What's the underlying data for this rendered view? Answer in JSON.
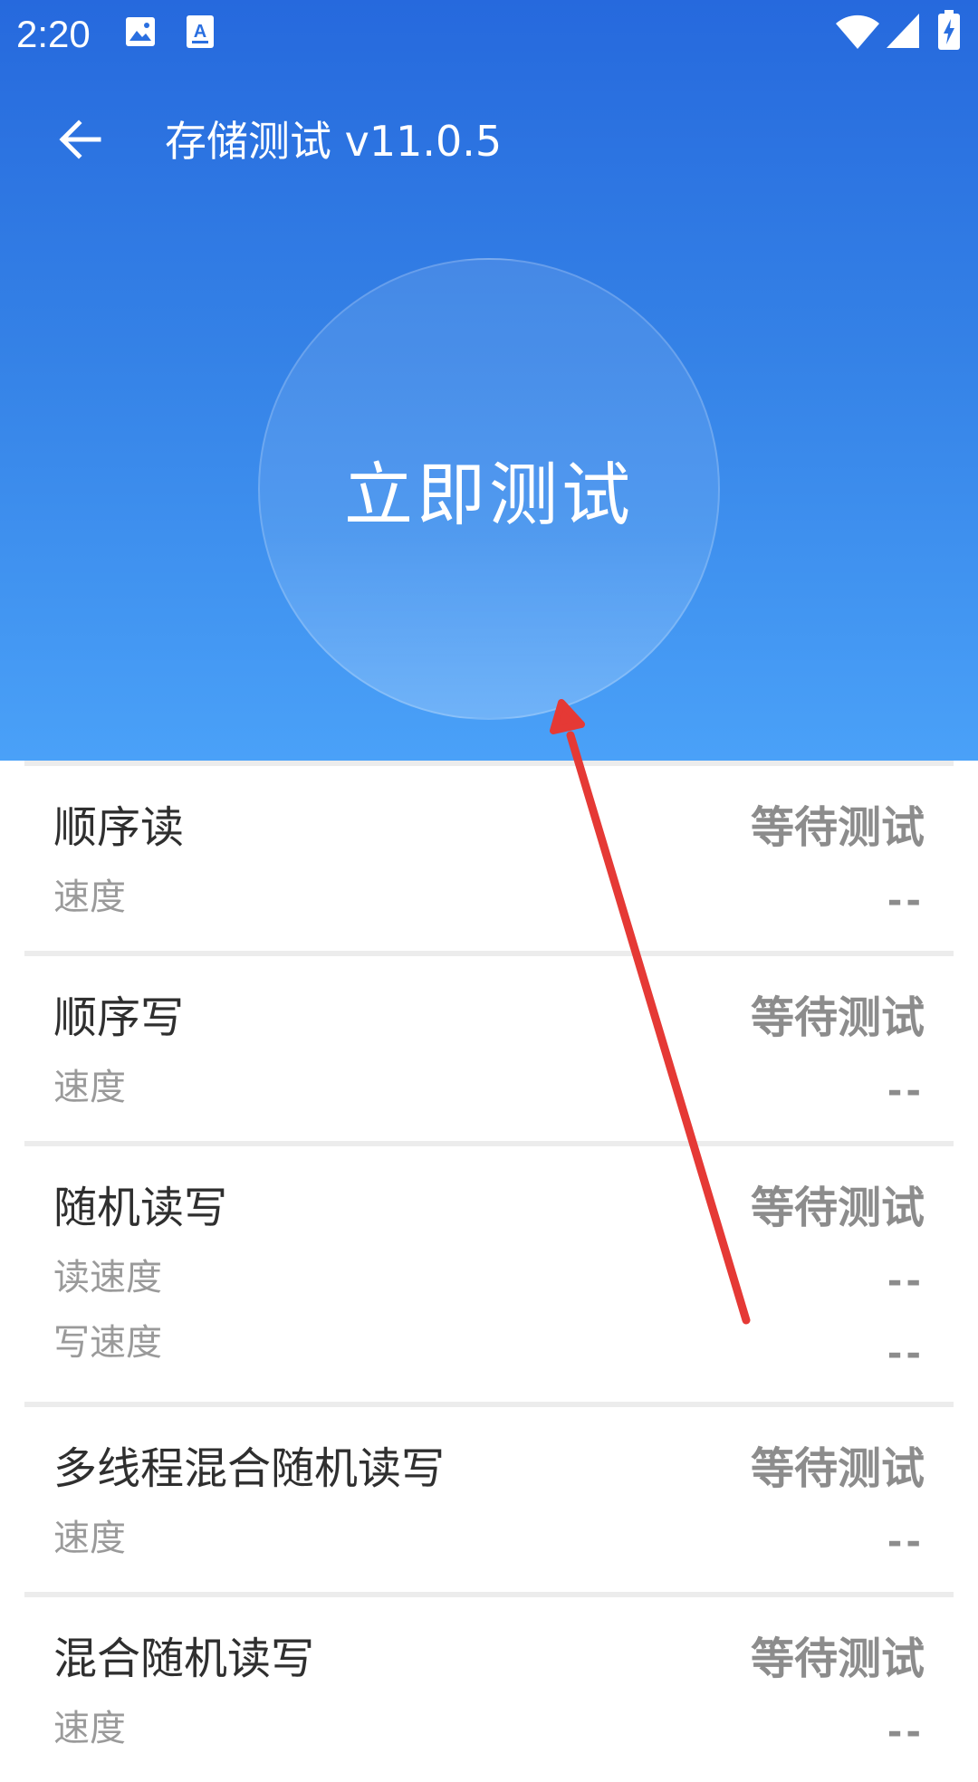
{
  "status_bar": {
    "time": "2:20",
    "icons": [
      "image-icon",
      "a-badge-icon",
      "wifi-icon",
      "signal-icon",
      "battery-charging-icon"
    ]
  },
  "toolbar": {
    "title": "存储测试 v11.0.5",
    "back_icon": "arrow-left-icon"
  },
  "main_button": {
    "label": "立即测试"
  },
  "tests": [
    {
      "title": "顺序读",
      "status": "等待测试",
      "metrics": [
        {
          "label": "速度",
          "value": "--"
        }
      ]
    },
    {
      "title": "顺序写",
      "status": "等待测试",
      "metrics": [
        {
          "label": "速度",
          "value": "--"
        }
      ]
    },
    {
      "title": "随机读写",
      "status": "等待测试",
      "metrics": [
        {
          "label": "读速度",
          "value": "--"
        },
        {
          "label": "写速度",
          "value": "--"
        }
      ]
    },
    {
      "title": "多线程混合随机读写",
      "status": "等待测试",
      "metrics": [
        {
          "label": "速度",
          "value": "--"
        }
      ]
    },
    {
      "title": "混合随机读写",
      "status": "等待测试",
      "metrics": [
        {
          "label": "速度",
          "value": "--"
        }
      ]
    }
  ],
  "colors": {
    "header_top": "#2669dd",
    "header_bottom": "#4aa1f8",
    "annotation_arrow": "#e53935"
  }
}
